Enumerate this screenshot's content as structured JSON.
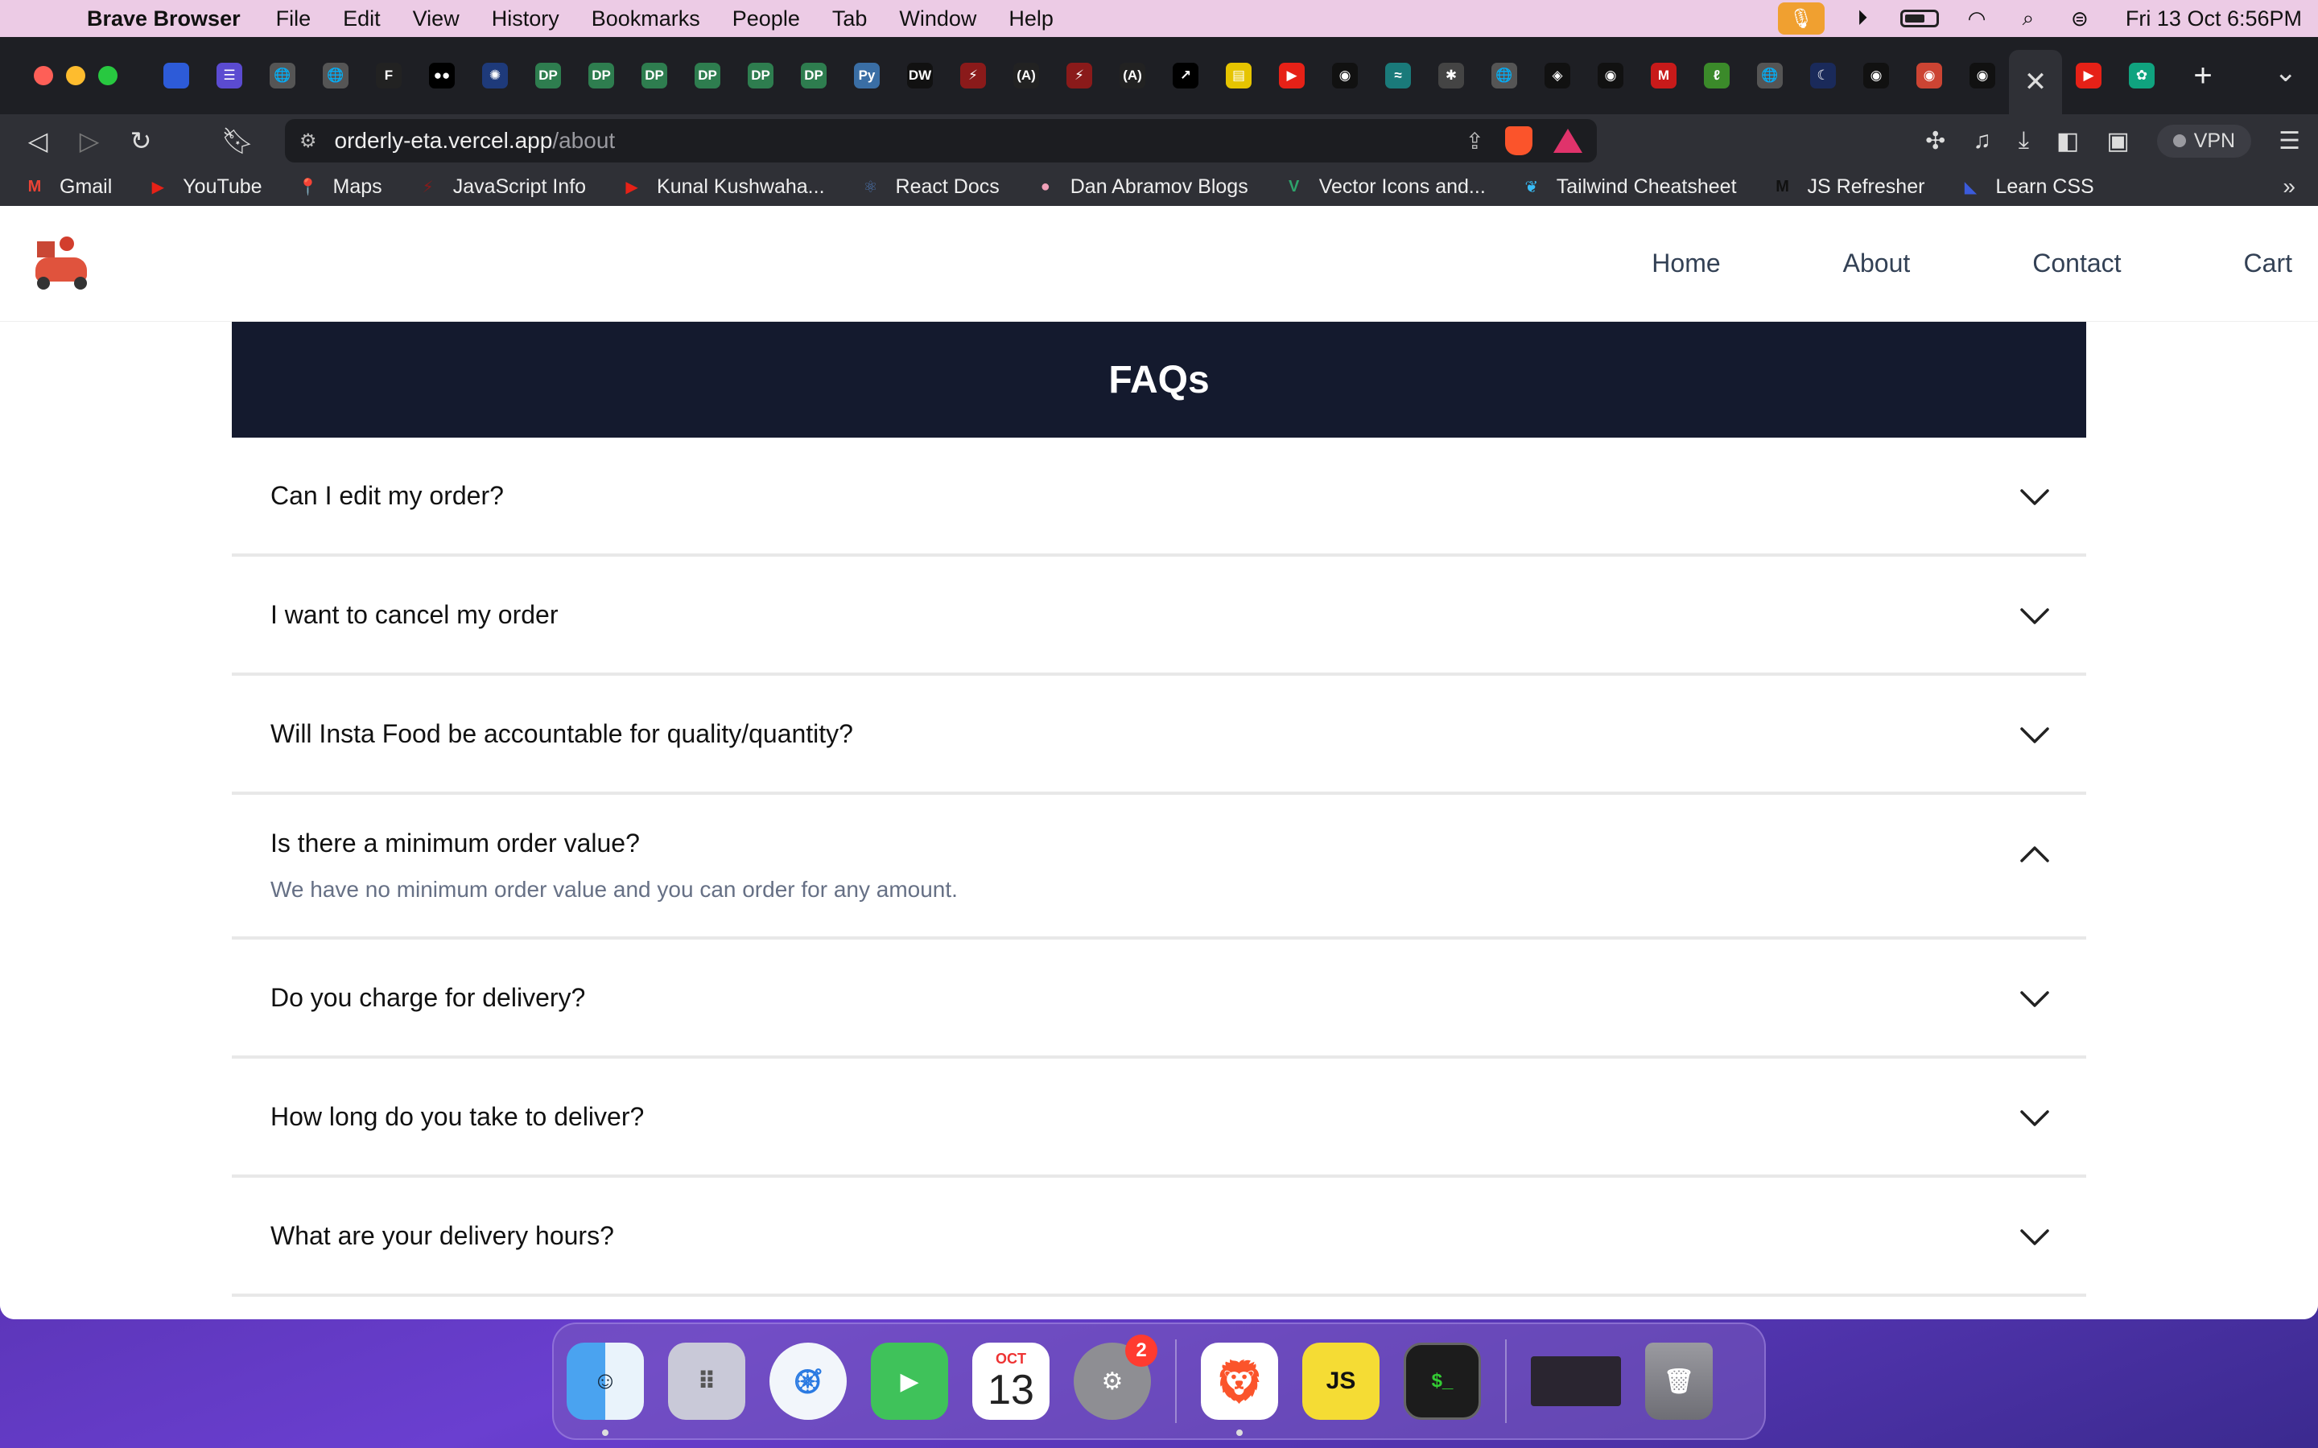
{
  "menubar": {
    "app_name": "Brave Browser",
    "menus": [
      "File",
      "Edit",
      "View",
      "History",
      "Bookmarks",
      "People",
      "Tab",
      "Window",
      "Help"
    ],
    "clock": "Fri 13 Oct  6:56PM"
  },
  "tabs": [
    {
      "icon": "blue-square-icon",
      "glyph": "",
      "color": "#2d5bd8"
    },
    {
      "icon": "list-icon",
      "glyph": "☰",
      "color": "#5b4bd1"
    },
    {
      "icon": "globe-icon",
      "glyph": "🌐",
      "color": "#555"
    },
    {
      "icon": "globe-icon",
      "glyph": "🌐",
      "color": "#555"
    },
    {
      "icon": "framer-icon",
      "glyph": "F",
      "color": "#222"
    },
    {
      "icon": "medium-icon",
      "glyph": "●●",
      "color": "#000"
    },
    {
      "icon": "sparkle-icon",
      "glyph": "✺",
      "color": "#1e3a7a"
    },
    {
      "icon": "dp-icon",
      "glyph": "DP",
      "color": "#2e7d4f"
    },
    {
      "icon": "dp-icon",
      "glyph": "DP",
      "color": "#2e7d4f"
    },
    {
      "icon": "dp-icon",
      "glyph": "DP",
      "color": "#2e7d4f"
    },
    {
      "icon": "dp-icon",
      "glyph": "DP",
      "color": "#2e7d4f"
    },
    {
      "icon": "dp-icon",
      "glyph": "DP",
      "color": "#2e7d4f"
    },
    {
      "icon": "dp-icon",
      "glyph": "DP",
      "color": "#2e7d4f"
    },
    {
      "icon": "python-icon",
      "glyph": "Py",
      "color": "#3a6ea5"
    },
    {
      "icon": "dw-icon",
      "glyph": "DW",
      "color": "#111"
    },
    {
      "icon": "figure-icon",
      "glyph": "⚡",
      "color": "#8a1a1a"
    },
    {
      "icon": "react-icon",
      "glyph": "(A)",
      "color": "#222"
    },
    {
      "icon": "figure-icon",
      "glyph": "⚡",
      "color": "#8a1a1a"
    },
    {
      "icon": "react-icon",
      "glyph": "(A)",
      "color": "#222"
    },
    {
      "icon": "arrow-icon",
      "glyph": "↗",
      "color": "#000"
    },
    {
      "icon": "notes-icon",
      "glyph": "▤",
      "color": "#e6c400"
    },
    {
      "icon": "youtube-icon",
      "glyph": "▶",
      "color": "#e62117"
    },
    {
      "icon": "github-icon",
      "glyph": "◉",
      "color": "#111"
    },
    {
      "icon": "wave-icon",
      "glyph": "≈",
      "color": "#1a7a7a"
    },
    {
      "icon": "gear-icon",
      "glyph": "✱",
      "color": "#444"
    },
    {
      "icon": "globe-icon",
      "glyph": "🌐",
      "color": "#555"
    },
    {
      "icon": "codepen-icon",
      "glyph": "◈",
      "color": "#111"
    },
    {
      "icon": "github-icon",
      "glyph": "◉",
      "color": "#111"
    },
    {
      "icon": "m-icon",
      "glyph": "M",
      "color": "#c81a1a"
    },
    {
      "icon": "leaf-icon",
      "glyph": "ℓ",
      "color": "#3b8a2a"
    },
    {
      "icon": "globe-icon",
      "glyph": "🌐",
      "color": "#555"
    },
    {
      "icon": "moon-icon",
      "glyph": "☾",
      "color": "#1a2a5a"
    },
    {
      "icon": "github-icon",
      "glyph": "◉",
      "color": "#111"
    },
    {
      "icon": "record-icon",
      "glyph": "◉",
      "color": "#c43"
    },
    {
      "icon": "github-icon",
      "glyph": "◉",
      "color": "#111"
    }
  ],
  "active_tab": {
    "icon": "close-icon",
    "glyph": "✕"
  },
  "after_active_tabs": [
    {
      "icon": "youtube-icon",
      "glyph": "▶",
      "color": "#e62117"
    },
    {
      "icon": "openai-icon",
      "glyph": "✿",
      "color": "#10a37f"
    }
  ],
  "toolbar": {
    "url_host": "orderly-eta.vercel.app",
    "url_path": "/about",
    "vpn_label": "VPN"
  },
  "bookmarks": [
    {
      "label": "Gmail",
      "icon": "gmail-icon",
      "glyph": "M",
      "color": "#ea4335"
    },
    {
      "label": "YouTube",
      "icon": "youtube-icon",
      "glyph": "▶",
      "color": "#e62117"
    },
    {
      "label": "Maps",
      "icon": "maps-pin-icon",
      "glyph": "📍",
      "color": "#34a853"
    },
    {
      "label": "JavaScript Info",
      "icon": "figure-icon",
      "glyph": "⚡",
      "color": "#8a1a1a"
    },
    {
      "label": "Kunal Kushwaha...",
      "icon": "youtube-icon",
      "glyph": "▶",
      "color": "#e62117"
    },
    {
      "label": "React Docs",
      "icon": "react-icon",
      "glyph": "⚛",
      "color": "#4a6fa5"
    },
    {
      "label": "Dan Abramov Blogs",
      "icon": "circle-avatar-icon",
      "glyph": "●",
      "color": "#f0a0b8"
    },
    {
      "label": "Vector Icons and...",
      "icon": "vector-icon",
      "glyph": "V",
      "color": "#2ea36b"
    },
    {
      "label": "Tailwind Cheatsheet",
      "icon": "leaf-icon",
      "glyph": "❦",
      "color": "#38bdf8"
    },
    {
      "label": "JS Refresher",
      "icon": "m-icon",
      "glyph": "M",
      "color": "#111"
    },
    {
      "label": "Learn CSS",
      "icon": "css-icon",
      "glyph": "◣",
      "color": "#3b5bdb"
    }
  ],
  "site": {
    "nav": [
      "Home",
      "About",
      "Contact",
      "Cart"
    ],
    "faq_title": "FAQs",
    "faqs": [
      {
        "q": "Can I edit my order?",
        "open": false
      },
      {
        "q": "I want to cancel my order",
        "open": false
      },
      {
        "q": "Will Insta Food be accountable for quality/quantity?",
        "open": false
      },
      {
        "q": "Is there a minimum order value?",
        "open": true,
        "a": "We have no minimum order value and you can order for any amount."
      },
      {
        "q": "Do you charge for delivery?",
        "open": false
      },
      {
        "q": "How long do you take to deliver?",
        "open": false
      },
      {
        "q": "What are your delivery hours?",
        "open": false
      }
    ]
  },
  "dock": {
    "calendar_month": "OCT",
    "calendar_day": "13",
    "settings_badge": "2"
  }
}
